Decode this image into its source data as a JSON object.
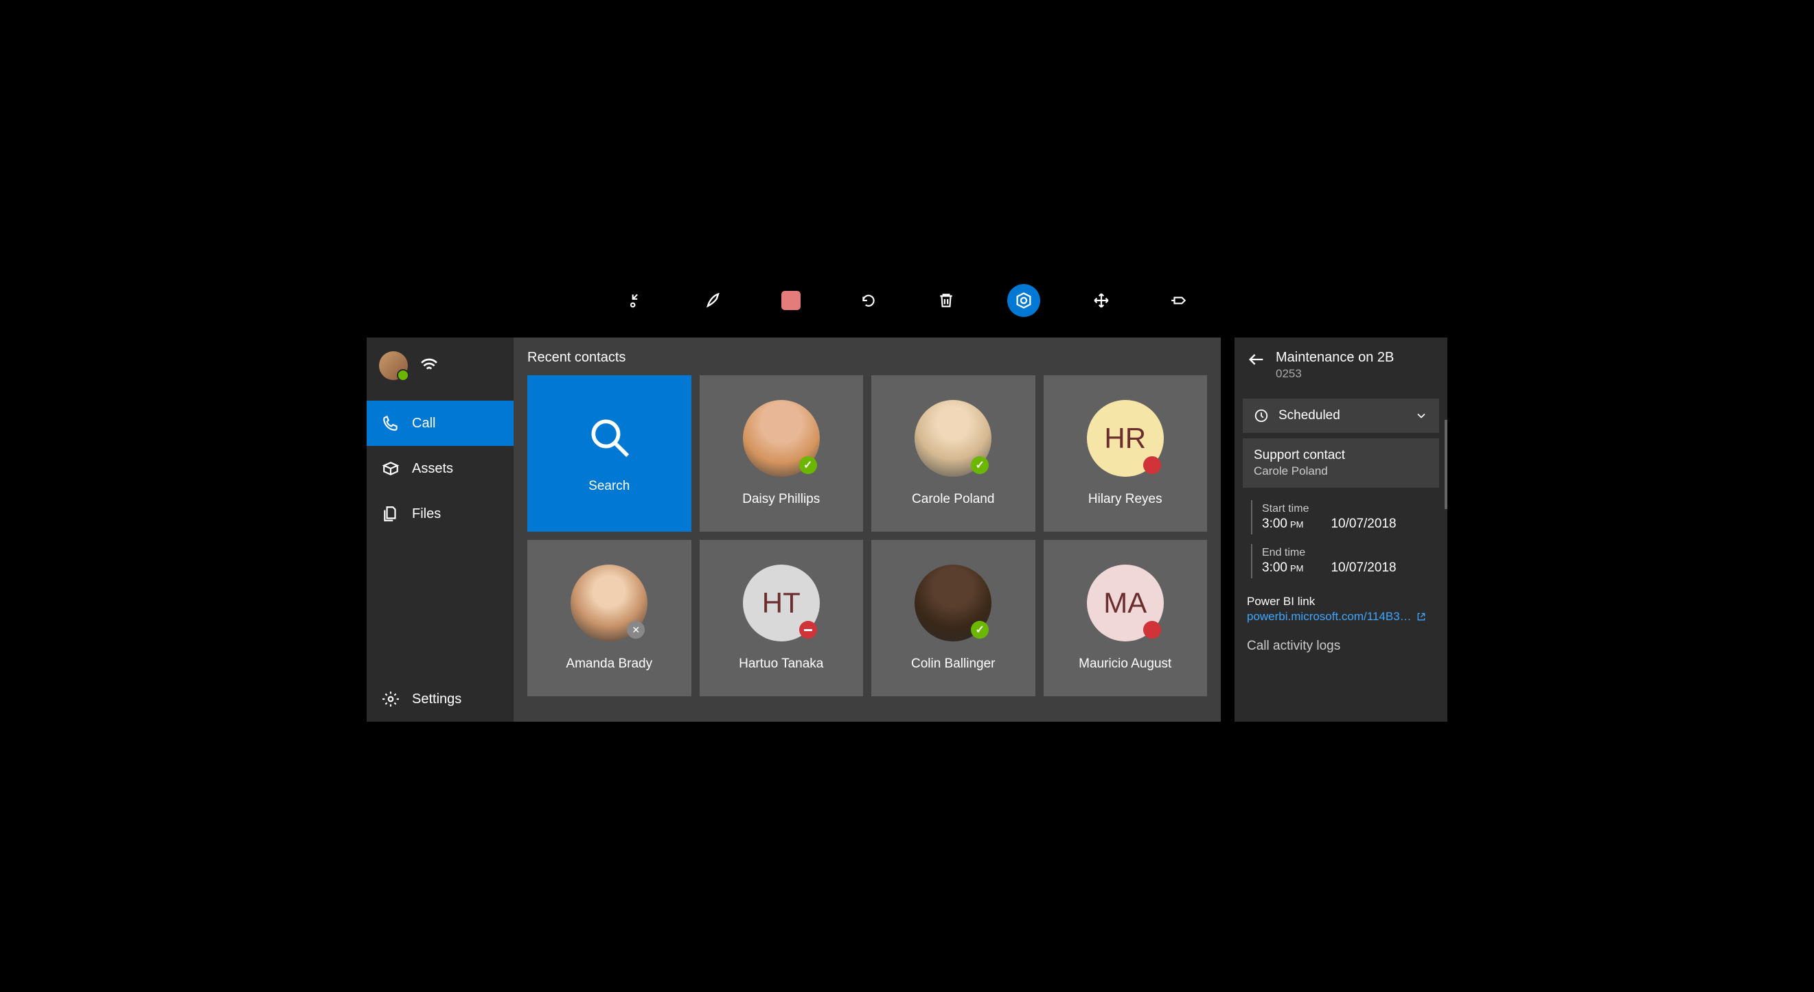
{
  "toolbar": {
    "items": [
      "collapse",
      "pen",
      "stop",
      "undo",
      "delete",
      "app",
      "move",
      "pin"
    ]
  },
  "sidebar": {
    "nav": [
      {
        "label": "Call"
      },
      {
        "label": "Assets"
      },
      {
        "label": "Files"
      }
    ],
    "settings_label": "Settings"
  },
  "main": {
    "heading": "Recent contacts",
    "search_label": "Search",
    "contacts": [
      {
        "name": "Daisy Phillips",
        "status": "online",
        "avatar": "photo1"
      },
      {
        "name": "Carole Poland",
        "status": "online",
        "avatar": "photo2"
      },
      {
        "name": "Hilary Reyes",
        "status": "busy",
        "avatar": "initials-yellow",
        "initials": "HR"
      },
      {
        "name": "Amanda Brady",
        "status": "offline",
        "avatar": "photo3"
      },
      {
        "name": "Hartuo Tanaka",
        "status": "dnd",
        "avatar": "initials-gray",
        "initials": "HT"
      },
      {
        "name": "Colin Ballinger",
        "status": "online",
        "avatar": "photo4"
      },
      {
        "name": "Mauricio August",
        "status": "busy",
        "avatar": "initials-pink",
        "initials": "MA"
      }
    ]
  },
  "details": {
    "title": "Maintenance on 2B",
    "subtitle": "0253",
    "status_label": "Scheduled",
    "support_label": "Support contact",
    "support_value": "Carole Poland",
    "start_label": "Start time",
    "start_time": "3:00",
    "start_ampm": "PM",
    "start_date": "10/07/2018",
    "end_label": "End time",
    "end_time": "3:00",
    "end_ampm": "PM",
    "end_date": "10/07/2018",
    "link_label": "Power BI link",
    "link_text": "powerbi.microsoft.com/114B3…",
    "activity_label": "Call activity logs"
  }
}
